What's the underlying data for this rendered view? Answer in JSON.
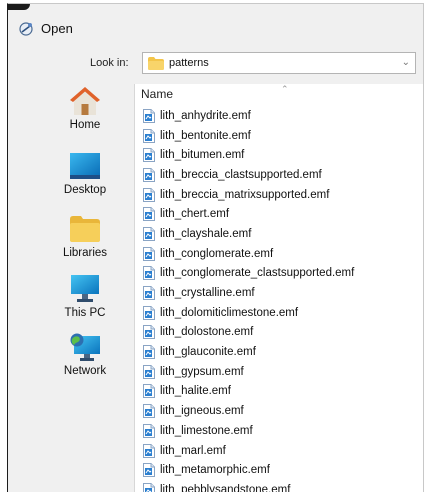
{
  "window": {
    "title": "Open"
  },
  "lookin": {
    "label": "Look in:",
    "value": "patterns"
  },
  "places": [
    {
      "label": "Home",
      "icon": "home-icon"
    },
    {
      "label": "Desktop",
      "icon": "desktop-icon"
    },
    {
      "label": "Libraries",
      "icon": "libraries-folder-icon"
    },
    {
      "label": "This PC",
      "icon": "computer-icon"
    },
    {
      "label": "Network",
      "icon": "network-icon"
    }
  ],
  "filelist": {
    "column_name": "Name",
    "files": [
      "lith_anhydrite.emf",
      "lith_bentonite.emf",
      "lith_bitumen.emf",
      "lith_breccia_clastsupported.emf",
      "lith_breccia_matrixsupported.emf",
      "lith_chert.emf",
      "lith_clayshale.emf",
      "lith_conglomerate.emf",
      "lith_conglomerate_clastsupported.emf",
      "lith_crystalline.emf",
      "lith_dolomiticlimestone.emf",
      "lith_dolostone.emf",
      "lith_glauconite.emf",
      "lith_gypsum.emf",
      "lith_halite.emf",
      "lith_igneous.emf",
      "lith_limestone.emf",
      "lith_marl.emf",
      "lith_metamorphic.emf",
      "lith_pebblysandstone.emf"
    ]
  },
  "colors": {
    "accent": "#0078d7",
    "folder": "#f3c54a",
    "panel": "#f0f0f0"
  }
}
